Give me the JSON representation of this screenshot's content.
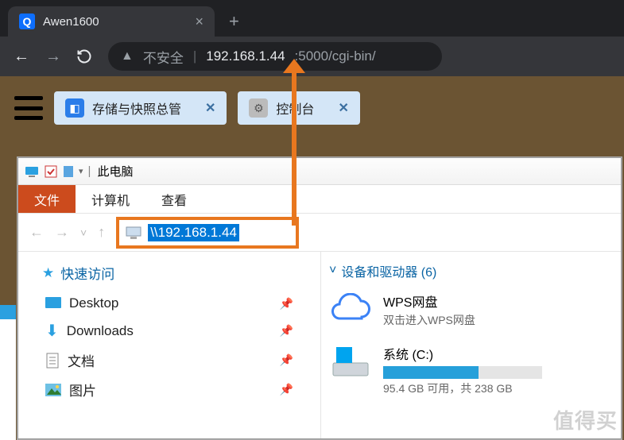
{
  "browser": {
    "tab_title": "Awen1600",
    "security_label": "不安全",
    "url_host": "192.168.1.44",
    "url_rest": ":5000/cgi-bin/"
  },
  "nas": {
    "tab1": "存储与快照总管",
    "tab2": "控制台"
  },
  "explorer": {
    "title": "此电脑",
    "ribbon": {
      "file": "文件",
      "computer": "计算机",
      "view": "查看"
    },
    "address_value": "\\\\192.168.1.44",
    "sidebar": {
      "header": "快速访问",
      "items": [
        {
          "label": "Desktop"
        },
        {
          "label": "Downloads"
        },
        {
          "label": "文档"
        },
        {
          "label": "图片"
        }
      ]
    },
    "main": {
      "section_header": "设备和驱动器 (6)",
      "drives": [
        {
          "title": "WPS网盘",
          "subtitle": "双击进入WPS网盘"
        },
        {
          "title": "系统 (C:)",
          "capacity_text": "95.4 GB 可用，共 238 GB",
          "used_pct": 60
        }
      ]
    }
  },
  "watermark": "值得买"
}
